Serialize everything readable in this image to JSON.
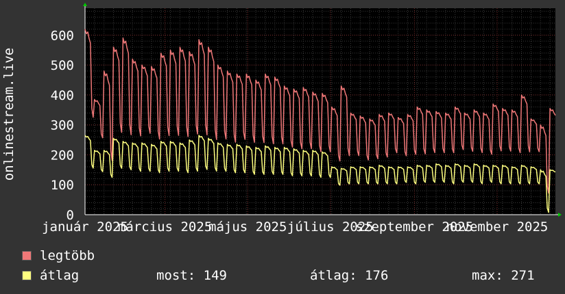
{
  "chart_data": {
    "type": "line",
    "ylabel": "onlinestream.live",
    "y_ticks": [
      0,
      100,
      200,
      300,
      400,
      500,
      600
    ],
    "ylim": [
      0,
      690
    ],
    "x_tick_labels": [
      "január 2025",
      "március 2025",
      "május 2025",
      "július 2025",
      "szeptember 2025",
      "november 2025"
    ],
    "x_tick_dates": [
      "2025-01-01",
      "2025-03-01",
      "2025-05-01",
      "2025-07-01",
      "2025-09-01",
      "2025-11-01"
    ],
    "x_range": [
      "2025-01-01",
      "2025-12-14"
    ],
    "grid": true,
    "legend_position": "bottom-left",
    "series": [
      {
        "name": "legtöbb",
        "color": "#f07878",
        "dates": [
          "2025-01-01",
          "2025-01-08",
          "2025-01-15",
          "2025-01-22",
          "2025-01-29",
          "2025-02-05",
          "2025-02-12",
          "2025-02-19",
          "2025-02-26",
          "2025-03-05",
          "2025-03-12",
          "2025-03-19",
          "2025-03-26",
          "2025-04-02",
          "2025-04-09",
          "2025-04-16",
          "2025-04-23",
          "2025-04-30",
          "2025-05-07",
          "2025-05-14",
          "2025-05-21",
          "2025-05-28",
          "2025-06-04",
          "2025-06-11",
          "2025-06-18",
          "2025-06-25",
          "2025-07-02",
          "2025-07-09",
          "2025-07-16",
          "2025-07-23",
          "2025-07-30",
          "2025-08-06",
          "2025-08-13",
          "2025-08-20",
          "2025-08-27",
          "2025-09-03",
          "2025-09-10",
          "2025-09-17",
          "2025-09-24",
          "2025-10-01",
          "2025-10-08",
          "2025-10-15",
          "2025-10-22",
          "2025-10-29",
          "2025-11-05",
          "2025-11-12",
          "2025-11-19",
          "2025-11-26",
          "2025-12-03",
          "2025-12-10"
        ],
        "weekly_peak": [
          620,
          385,
          480,
          560,
          590,
          520,
          500,
          495,
          540,
          550,
          560,
          545,
          585,
          560,
          500,
          480,
          470,
          470,
          450,
          470,
          460,
          430,
          420,
          425,
          410,
          405,
          360,
          430,
          340,
          330,
          320,
          335,
          340,
          325,
          335,
          360,
          350,
          345,
          340,
          360,
          340,
          350,
          340,
          370,
          355,
          350,
          400,
          320,
          300,
          355
        ],
        "weekly_low": [
          310,
          250,
          165,
          260,
          250,
          250,
          260,
          240,
          250,
          250,
          245,
          255,
          250,
          235,
          240,
          230,
          240,
          230,
          230,
          225,
          225,
          215,
          210,
          210,
          200,
          200,
          170,
          185,
          190,
          175,
          180,
          185,
          200,
          190,
          195,
          195,
          200,
          200,
          200,
          210,
          205,
          200,
          195,
          205,
          205,
          200,
          200,
          205,
          60,
          200
        ]
      },
      {
        "name": "átlag",
        "color": "#ffff80",
        "dates": [
          "2025-01-01",
          "2025-01-08",
          "2025-01-15",
          "2025-01-22",
          "2025-01-29",
          "2025-02-05",
          "2025-02-12",
          "2025-02-19",
          "2025-02-26",
          "2025-03-05",
          "2025-03-12",
          "2025-03-19",
          "2025-03-26",
          "2025-04-02",
          "2025-04-09",
          "2025-04-16",
          "2025-04-23",
          "2025-04-30",
          "2025-05-07",
          "2025-05-14",
          "2025-05-21",
          "2025-05-28",
          "2025-06-04",
          "2025-06-11",
          "2025-06-18",
          "2025-06-25",
          "2025-07-02",
          "2025-07-09",
          "2025-07-16",
          "2025-07-23",
          "2025-07-30",
          "2025-08-06",
          "2025-08-13",
          "2025-08-20",
          "2025-08-27",
          "2025-09-03",
          "2025-09-10",
          "2025-09-17",
          "2025-09-24",
          "2025-10-01",
          "2025-10-08",
          "2025-10-15",
          "2025-10-22",
          "2025-10-29",
          "2025-11-05",
          "2025-11-12",
          "2025-11-19",
          "2025-11-26",
          "2025-12-03",
          "2025-12-10"
        ],
        "weekly_peak": [
          265,
          215,
          215,
          255,
          245,
          240,
          240,
          235,
          245,
          245,
          240,
          250,
          265,
          255,
          240,
          235,
          235,
          230,
          225,
          230,
          225,
          225,
          220,
          215,
          215,
          210,
          160,
          155,
          160,
          160,
          160,
          165,
          160,
          160,
          160,
          165,
          165,
          170,
          165,
          170,
          165,
          170,
          165,
          165,
          165,
          160,
          165,
          160,
          150,
          150
        ],
        "weekly_low": [
          150,
          140,
          120,
          150,
          145,
          140,
          140,
          135,
          140,
          140,
          135,
          140,
          145,
          140,
          140,
          135,
          135,
          130,
          130,
          130,
          130,
          125,
          125,
          125,
          120,
          120,
          95,
          100,
          100,
          100,
          100,
          100,
          100,
          105,
          100,
          105,
          105,
          105,
          100,
          105,
          105,
          100,
          105,
          100,
          100,
          100,
          100,
          100,
          0,
          100
        ]
      }
    ]
  },
  "legend": {
    "items": [
      {
        "label": "legtöbb",
        "color": "#f07878"
      },
      {
        "label": "átlag",
        "color": "#ffff80"
      }
    ]
  },
  "stats": {
    "now": "most: 149",
    "avg": "átlag: 176",
    "max": "max: 271"
  }
}
